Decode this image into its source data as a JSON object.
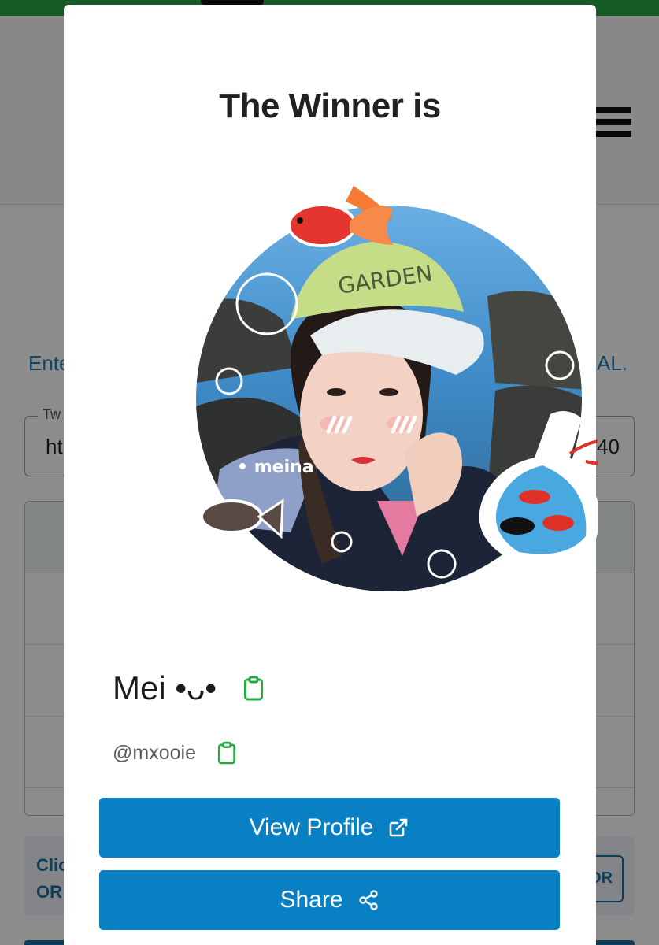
{
  "background_page": {
    "intro_text_left": "Ente",
    "intro_text_right": "AL.",
    "input_label": "Tw",
    "input_value_left": "ht",
    "input_value_right": "40",
    "info_line1": "Clic",
    "info_line2": "OR",
    "info_button": "OR"
  },
  "modal": {
    "title": "The Winner is",
    "avatar_caption": "• meina",
    "winner_name": "Mei •ᴗ•",
    "winner_handle": "@mxooie",
    "buttons": {
      "view_profile": "View Profile",
      "share": "Share"
    }
  },
  "icons": {
    "copy": "clipboard-icon",
    "external": "external-link-icon",
    "share": "share-icon",
    "menu": "hamburger-menu-icon"
  },
  "colors": {
    "primary_button": "#0a80c4",
    "copy_icon": "#28a745",
    "top_bar": "#28a745"
  }
}
